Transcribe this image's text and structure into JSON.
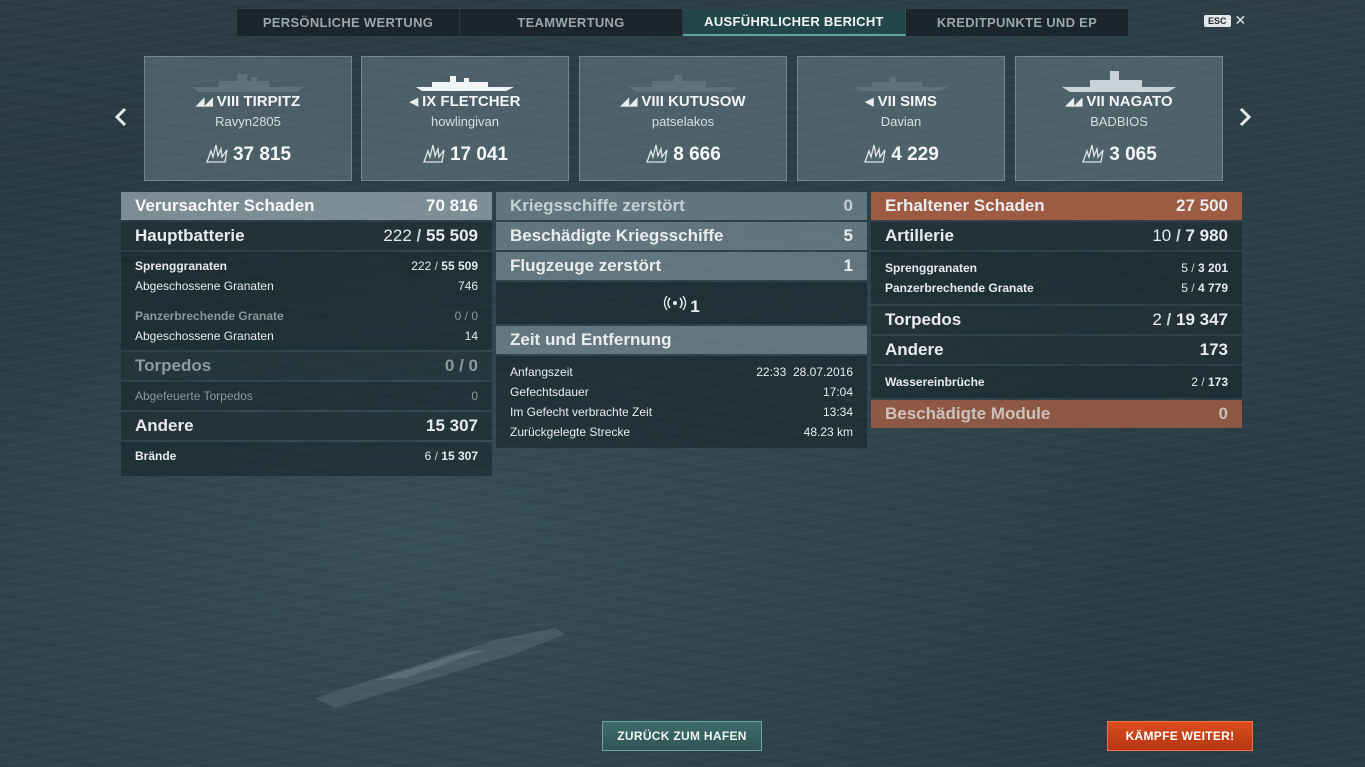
{
  "tabs": [
    {
      "label": "PERSÖNLICHE WERTUNG",
      "active": false
    },
    {
      "label": "TEAMWERTUNG",
      "active": false
    },
    {
      "label": "AUSFÜHRLICHER BERICHT",
      "active": true
    },
    {
      "label": "KREDITPUNKTE UND EP",
      "active": false
    }
  ],
  "esc_label": "ESC",
  "ships": [
    {
      "tier_name": "VIII TIRPITZ",
      "player": "Ravyn2805",
      "damage": "37 815",
      "class_icon": "battleship-icon"
    },
    {
      "tier_name": "IX FLETCHER",
      "player": "howlingivan",
      "damage": "17 041",
      "class_icon": "destroyer-icon"
    },
    {
      "tier_name": "VIII KUTUSOW",
      "player": "patselakos",
      "damage": "8 666",
      "class_icon": "cruiser-icon"
    },
    {
      "tier_name": "VII SIMS",
      "player": "Davian",
      "damage": "4 229",
      "class_icon": "destroyer-icon"
    },
    {
      "tier_name": "VII NAGATO",
      "player": "BADBIOS",
      "damage": "3 065",
      "class_icon": "battleship-icon"
    }
  ],
  "left": {
    "dealt": {
      "label": "Verursachter Schaden",
      "value": "70 816"
    },
    "main": {
      "label": "Hauptbatterie",
      "a": "222",
      "b": "55 509"
    },
    "he": {
      "label": "Sprenggranaten",
      "a": "222",
      "b": "55 509"
    },
    "he_fired": {
      "label": "Abgeschossene Granaten",
      "value": "746"
    },
    "ap": {
      "label": "Panzerbrechende Granate",
      "a": "0",
      "b": "0"
    },
    "ap_fired": {
      "label": "Abgeschossene Granaten",
      "value": "14"
    },
    "torp": {
      "label": "Torpedos",
      "a": "0",
      "b": "0"
    },
    "torp_fired": {
      "label": "Abgefeuerte Torpedos",
      "value": "0"
    },
    "other": {
      "label": "Andere",
      "value": "15 307"
    },
    "fires": {
      "label": "Brände",
      "a": "6",
      "b": "15 307"
    }
  },
  "mid": {
    "destroyed": {
      "label": "Kriegsschiffe zerstört",
      "value": "0"
    },
    "damaged": {
      "label": "Beschädigte Kriegsschiffe",
      "value": "5"
    },
    "planes": {
      "label": "Flugzeuge zerstört",
      "value": "1"
    },
    "spotted": {
      "value": "1",
      "icon": "radio-signal-icon"
    },
    "time_title": "Zeit und Entfernung",
    "start": {
      "label": "Anfangszeit",
      "time": "22:33",
      "date": "28.07.2016"
    },
    "duration": {
      "label": "Gefechtsdauer",
      "value": "17:04"
    },
    "in_battle": {
      "label": "Im Gefecht verbrachte Zeit",
      "value": "13:34"
    },
    "distance": {
      "label": "Zurückgelegte Strecke",
      "value": "48.23 km"
    }
  },
  "right": {
    "received": {
      "label": "Erhaltener Schaden",
      "value": "27 500"
    },
    "artillery": {
      "label": "Artillerie",
      "a": "10",
      "b": "7 980"
    },
    "he": {
      "label": "Sprenggranaten",
      "a": "5",
      "b": "3 201"
    },
    "ap": {
      "label": "Panzerbrechende Granate",
      "a": "5",
      "b": "4 779"
    },
    "torp": {
      "label": "Torpedos",
      "a": "2",
      "b": "19 347"
    },
    "other": {
      "label": "Andere",
      "value": "173"
    },
    "flooding": {
      "label": "Wassereinbrüche",
      "a": "2",
      "b": "173"
    },
    "modules": {
      "label": "Beschädigte Module",
      "value": "0"
    }
  },
  "buttons": {
    "port": "ZURÜCK ZUM HAFEN",
    "battle": "KÄMPFE WEITER!"
  },
  "colors": {
    "accent": "#5fa7a5",
    "battle_button": "#c9401a",
    "received_header": "#b26042"
  }
}
